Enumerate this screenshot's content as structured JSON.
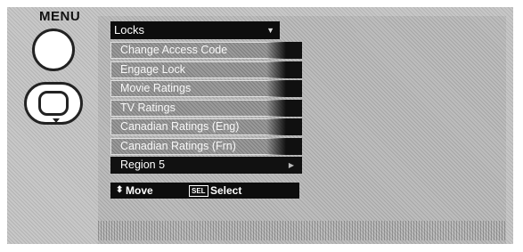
{
  "remote": {
    "menu_label": "MENU"
  },
  "menu": {
    "title": "Locks",
    "items": [
      {
        "label": "Change Access Code"
      },
      {
        "label": "Engage Lock"
      },
      {
        "label": "Movie Ratings"
      },
      {
        "label": "TV Ratings"
      },
      {
        "label": "Canadian Ratings (Eng)"
      },
      {
        "label": "Canadian Ratings (Frn)"
      },
      {
        "label": "Region 5"
      }
    ],
    "selected_index": 6
  },
  "hints": {
    "move_label": "Move",
    "sel_key": "SEL",
    "select_label": "Select"
  }
}
